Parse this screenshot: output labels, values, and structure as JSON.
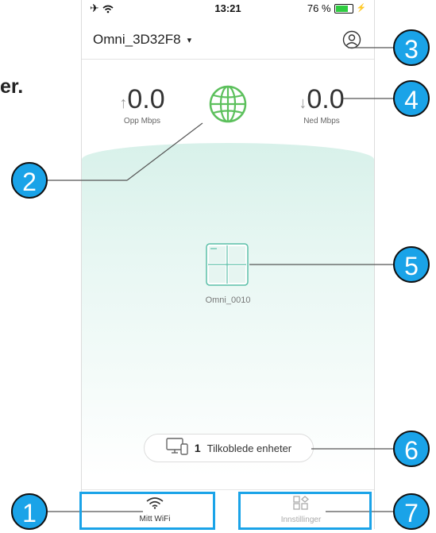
{
  "page": {
    "side_text": "er."
  },
  "status_bar": {
    "time": "13:21",
    "battery": "76 %",
    "battery_level": 0.76
  },
  "header": {
    "network_name": "Omni_3D32F8",
    "caret": "▾"
  },
  "speeds": {
    "upload": {
      "value": "0.0",
      "label": "Opp Mbps",
      "arrow": "↑"
    },
    "download": {
      "value": "0.0",
      "label": "Ned Mbps",
      "arrow": "↓"
    }
  },
  "device": {
    "name": "Omni_0010"
  },
  "connected": {
    "count": "1",
    "label": "Tilkoblede enheter"
  },
  "tabs": [
    {
      "label": "Mitt WiFi",
      "icon": "wifi-icon",
      "active": true
    },
    {
      "label": "Innstillinger",
      "icon": "settings-grid-icon",
      "active": false
    }
  ],
  "callouts": [
    "1",
    "2",
    "3",
    "4",
    "5",
    "6",
    "7"
  ],
  "colors": {
    "callout": "#1aa3e8",
    "globe": "#5cc05c",
    "device": "#5bbfa8"
  }
}
